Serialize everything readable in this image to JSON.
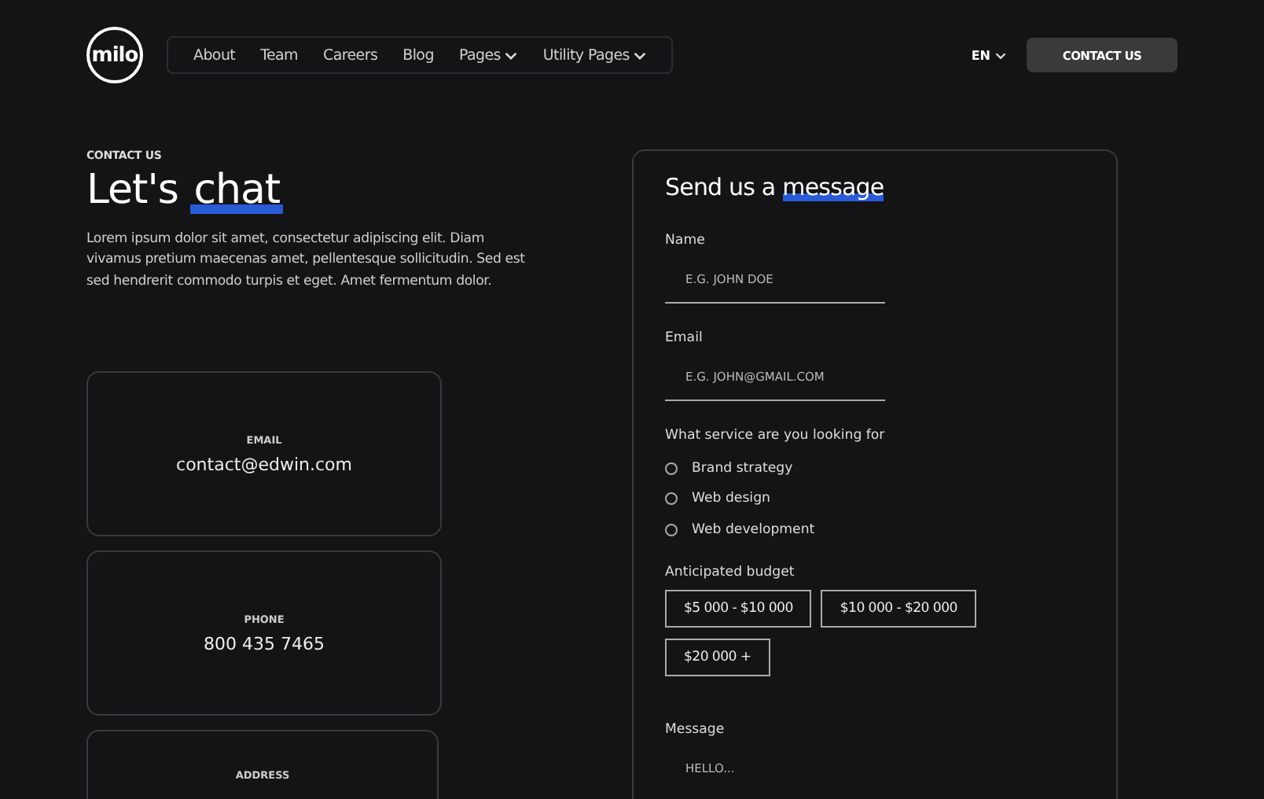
{
  "logo": "milo",
  "nav": [
    {
      "label": "About",
      "has_menu": false
    },
    {
      "label": "Team",
      "has_menu": false
    },
    {
      "label": "Careers",
      "has_menu": false
    },
    {
      "label": "Blog",
      "has_menu": false
    },
    {
      "label": "Pages",
      "has_menu": true
    },
    {
      "label": "Utility Pages",
      "has_menu": true
    }
  ],
  "language": "EN",
  "cta": "CONTACT US",
  "hero": {
    "eyebrow": "CONTACT US",
    "title": [
      {
        "text": "Let's",
        "highlight": false
      },
      {
        "text": "chat",
        "highlight": true
      }
    ],
    "body": "Lorem ipsum dolor sit amet, consectetur adipiscing elit. Diam vivamus pretium maecenas amet, pellentesque sollicitudin. Sed est sed hendrerit commodo turpis et eget. Amet fermentum dolor."
  },
  "contact_cards": [
    {
      "label": "EMAIL",
      "value": "contact@edwin.com"
    },
    {
      "label": "PHONE",
      "value": "800 435 7465"
    },
    {
      "label": "ADDRESS"
    }
  ],
  "form": {
    "title": [
      {
        "text": "Send us a",
        "highlight": false
      },
      {
        "text": "message",
        "highlight": true
      }
    ],
    "name": {
      "label": "Name",
      "placeholder": "E.G. JOHN DOE"
    },
    "email": {
      "label": "Email",
      "placeholder": "E.G. JOHN@GMAIL.COM"
    },
    "service": {
      "label": "What service are you looking for",
      "options": [
        {
          "label": "Brand strategy",
          "selected": false
        },
        {
          "label": "Web design",
          "selected": false
        },
        {
          "label": "Web development",
          "selected": false
        }
      ]
    },
    "budget": {
      "label": "Anticipated budget",
      "options": [
        {
          "label": "$5 000 - $10 000",
          "selected": false
        },
        {
          "label": "$10 000 - $20 000",
          "selected": false
        },
        {
          "label": "$20 000 +",
          "selected": false
        }
      ]
    },
    "message": {
      "label": "Message",
      "placeholder": "HELLO..."
    }
  }
}
